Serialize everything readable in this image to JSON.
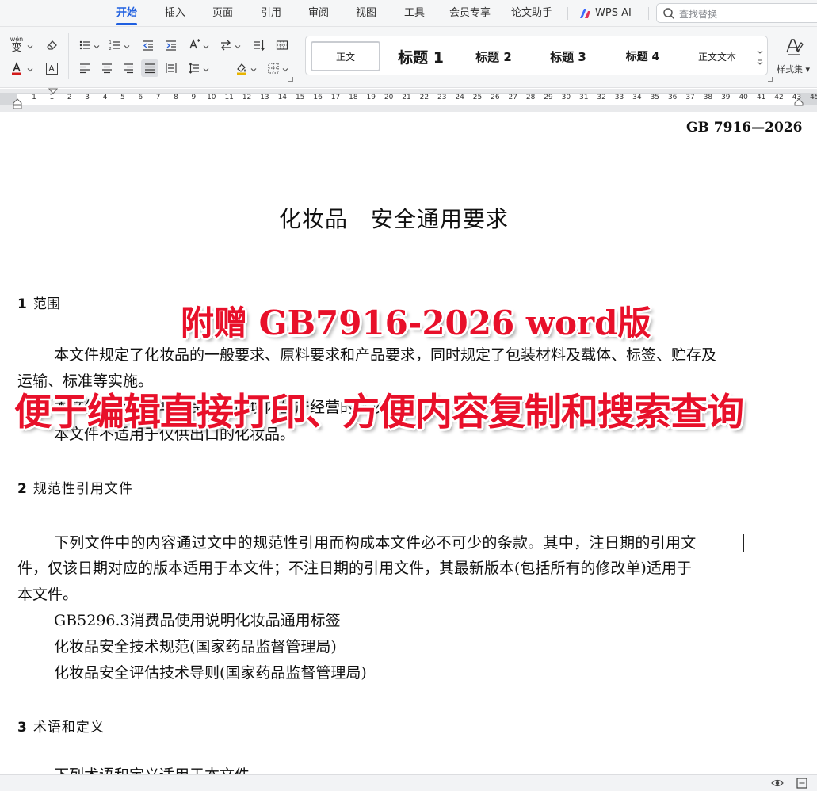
{
  "menu": {
    "tabs": [
      "开始",
      "插入",
      "页面",
      "引用",
      "审阅",
      "视图",
      "工具",
      "会员专享",
      "论文助手"
    ],
    "active_tab": "开始",
    "wps_ai": "WPS AI",
    "search_placeholder": "查找替换",
    "icons": [
      "wps-ai-logo-icon",
      "search-icon"
    ]
  },
  "toolbar": {
    "phonetic_label": "wén",
    "phonetic_char": "变",
    "char_border_label": "A",
    "font_color": "#d21a1a",
    "highlight_color": "#e8b400",
    "styles": [
      "正文",
      "标题 1",
      "标题 2",
      "标题 3",
      "标题 4",
      "正文文本"
    ],
    "selected_style": "正文",
    "styles_set_label": "样式集",
    "icons": [
      "phonetic-guide-icon",
      "clear-format-icon",
      "font-color-icon",
      "character-border-icon",
      "bullet-list-icon",
      "numbered-list-icon",
      "decrease-indent-icon",
      "increase-indent-icon",
      "text-direction-icon",
      "sort-icon",
      "line-spacing-icon",
      "align-left-icon",
      "align-center-icon",
      "align-right-icon",
      "justify-icon",
      "distributed-icon",
      "table-insert-icon",
      "shading-icon",
      "border-icon",
      "styles-set-icon"
    ]
  },
  "ruler": {
    "numbers": [
      "1",
      "1",
      "2",
      "3",
      "4",
      "5",
      "6",
      "7",
      "8",
      "9",
      "10",
      "11",
      "12",
      "13",
      "14",
      "15",
      "16",
      "17",
      "18",
      "19",
      "20",
      "21",
      "22",
      "23",
      "24",
      "25",
      "26",
      "27",
      "28",
      "29",
      "30",
      "31",
      "32",
      "33",
      "34",
      "35",
      "36",
      "37",
      "38",
      "39",
      "40",
      "41",
      "42",
      "43",
      "45"
    ]
  },
  "document": {
    "standard_number": "GB 7916—2026",
    "title": "化妆品　安全通用要求",
    "section1": {
      "number": "1",
      "heading": "范围",
      "para1_line1": "本文件规定了化妆品的一般要求、原料要求和产品要求，同时规定了包装材料及载体、标签、贮存及",
      "para1_line2": "运输、标准等实施。",
      "para2_line1": "本文件适用于中华人民共和国境内生产经营的化妆品。",
      "para3_line1": "本文件不适用于仅供出口的化妆品。"
    },
    "section2": {
      "number": "2",
      "heading": "规范性引用文件",
      "para1_line1": "下列文件中的内容通过文中的规范性引用而构成本文件必不可少的条款。其中，注日期的引用文",
      "para1_line2": "件，仅该日期对应的版本适用于本文件；不注日期的引用文件，其最新版本(包括所有的修改单)适用于",
      "para1_line3": "本文件。",
      "refs": [
        "GB5296.3消费品使用说明化妆品通用标签",
        "化妆品安全技术规范(国家药品监督管理局)",
        "化妆品安全评估技术导则(国家药品监督管理局)"
      ]
    },
    "section3": {
      "number": "3",
      "heading": "术语和定义",
      "para1_line1": "下列术语和定义适用于本文件。"
    }
  },
  "overlay": {
    "line1": "附赠 GB7916-2026 word版",
    "line2": "便于编辑直接打印、方便内容复制和搜索查询",
    "color": "#e8102a"
  },
  "statusbar": {
    "icons": [
      "reading-view-icon",
      "page-view-icon"
    ]
  }
}
